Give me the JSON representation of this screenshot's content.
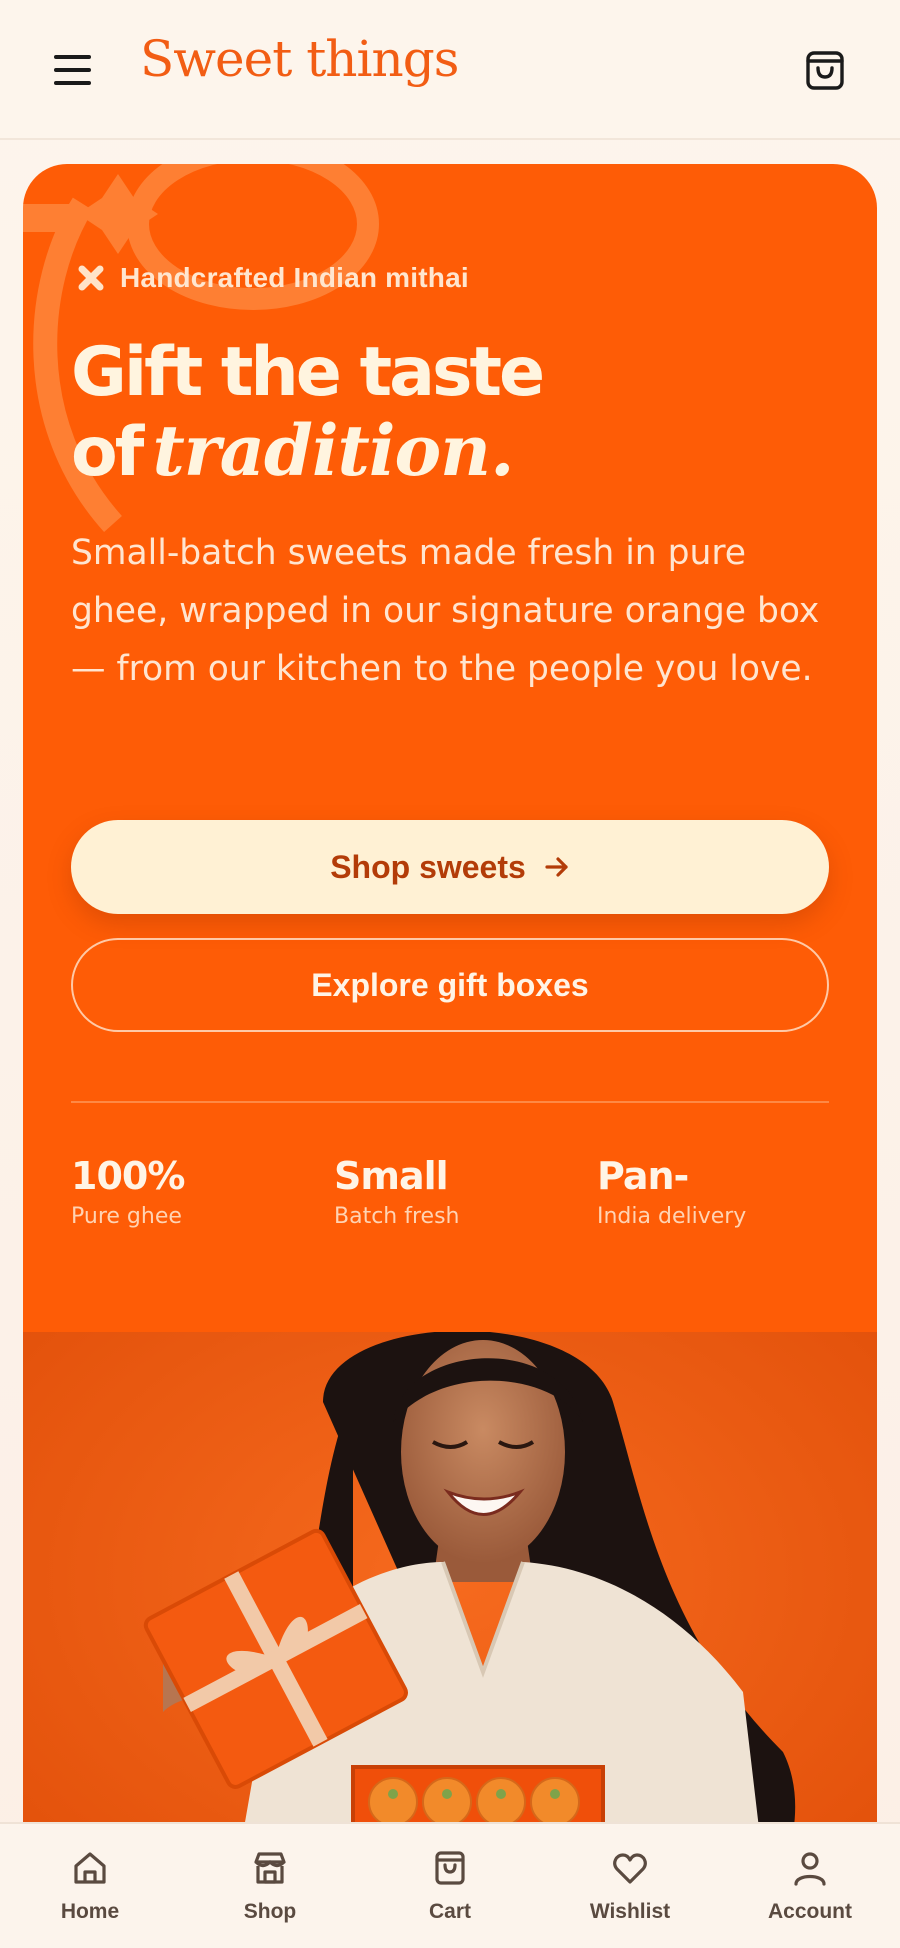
{
  "header": {
    "brand": "Sweet things"
  },
  "hero": {
    "eyebrow": "Handcrafted Indian mithai",
    "headline_line1": "Gift the taste",
    "headline_of": "of",
    "headline_emphasis": "tradition.",
    "lede": "Small-batch sweets made fresh in pure ghee, wrapped in our signature orange box — from our kitchen to the people you love.",
    "primary_cta": "Shop sweets",
    "secondary_cta": "Explore gift boxes",
    "stats": [
      {
        "value": "100%",
        "label": "Pure ghee"
      },
      {
        "value": "Small",
        "label": "Batch fresh"
      },
      {
        "value": "Pan-",
        "label": "India delivery"
      }
    ]
  },
  "bottom_nav": {
    "items": [
      {
        "label": "Home",
        "icon": "home-icon"
      },
      {
        "label": "Shop",
        "icon": "store-icon"
      },
      {
        "label": "Cart",
        "icon": "shopping-bag-icon"
      },
      {
        "label": "Wishlist",
        "icon": "heart-icon"
      },
      {
        "label": "Account",
        "icon": "user-icon"
      }
    ]
  },
  "colors": {
    "brand_orange": "#fe5c06",
    "cream": "#fff1d4",
    "page_bg": "#fdf5ec"
  }
}
